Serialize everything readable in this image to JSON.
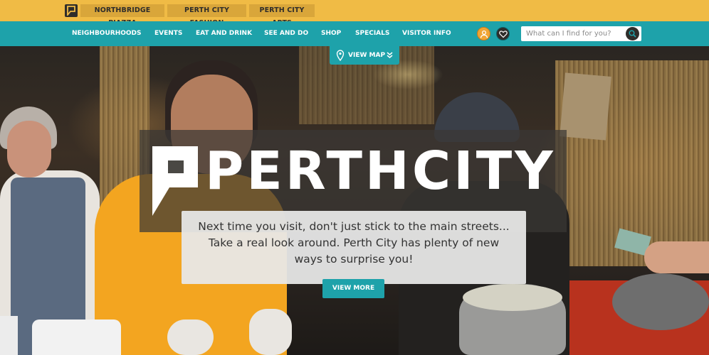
{
  "topbar": {
    "links": [
      "NORTHBRIDGE PIAZZA",
      "PERTH CITY FASHION",
      "PERTH CITY ARTS"
    ]
  },
  "nav": {
    "items": [
      "NEIGHBOURHOODS",
      "EVENTS",
      "EAT AND DRINK",
      "SEE AND DO",
      "SHOP",
      "SPECIALS",
      "VISITOR INFO"
    ]
  },
  "search": {
    "placeholder": "What can I find for you?"
  },
  "hero": {
    "view_map_label": "VIEW MAP",
    "logo_text": "PERTHCITY",
    "tagline": "Next time you visit, don't just stick to the main streets... Take a real look around. Perth City has plenty of new ways to surprise you!",
    "cta_label": "VIEW MORE"
  },
  "colors": {
    "accent_teal": "#1ea2aa",
    "top_yellow": "#f0bb45",
    "user_orange": "#f0a534"
  },
  "icons": [
    "logo-square-icon",
    "user-icon",
    "heart-icon",
    "search-icon",
    "map-pin-icon",
    "double-chevron-down-icon"
  ]
}
